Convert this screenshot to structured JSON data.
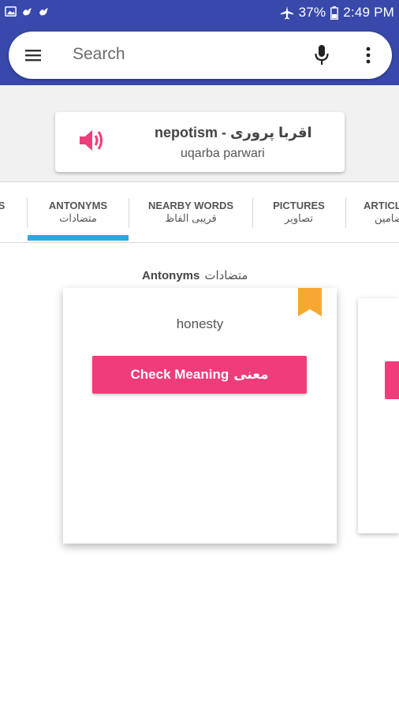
{
  "status_bar": {
    "left_icons": [
      "image-icon",
      "bird-icon",
      "bird-icon"
    ],
    "battery": "37%",
    "time": "2:49 PM"
  },
  "search": {
    "placeholder": "Search",
    "icons": [
      "menu-icon",
      "mic-icon",
      "more-vert-icon"
    ]
  },
  "word": {
    "title": "nepotism - اقربا پروری",
    "transliteration": "uqarba parwari",
    "speaker_icon": "speaker-icon"
  },
  "tabs": [
    {
      "en": "S",
      "ur": ""
    },
    {
      "en": "ANTONYMS",
      "ur": "متضادات",
      "selected": true
    },
    {
      "en": "NEARBY WORDS",
      "ur": "قریبی الفاظ"
    },
    {
      "en": "PICTURES",
      "ur": "تصاویر"
    },
    {
      "en": "ARTICL",
      "ur": "مضامین"
    }
  ],
  "content": {
    "section_label": "Antonyms",
    "section_label_ur": "متضادات",
    "card": {
      "word": "honesty",
      "button_label": "Check Meaning",
      "button_label_ur": "معنی",
      "bookmark_icon": "bookmark-icon"
    }
  },
  "colors": {
    "header": "#3949ab",
    "accent_pink": "#f03c7b",
    "tab_indicator": "#29a8e0",
    "bookmark": "#f7a833"
  }
}
